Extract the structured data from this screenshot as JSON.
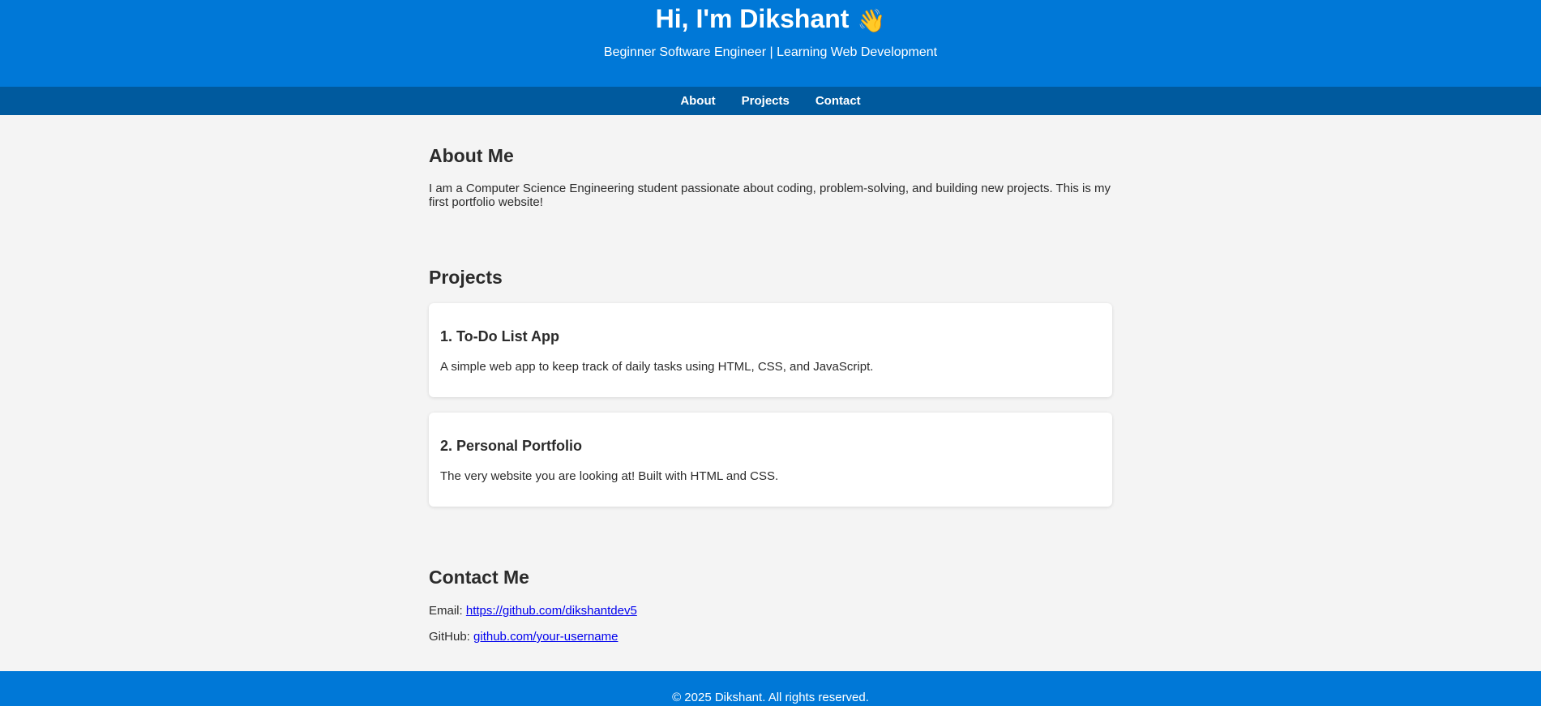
{
  "header": {
    "title": "Hi, I'm Dikshant",
    "wave_emoji": "👋",
    "subtitle": "Beginner Software Engineer | Learning Web Development",
    "background_color": "#0078d7"
  },
  "nav": {
    "background_color": "#005a9e",
    "items": [
      {
        "label": "About"
      },
      {
        "label": "Projects"
      },
      {
        "label": "Contact"
      }
    ]
  },
  "about": {
    "heading": "About Me",
    "text": "I am a Computer Science Engineering student passionate about coding, problem-solving, and building new projects. This is my first portfolio website!"
  },
  "projects": {
    "heading": "Projects",
    "items": [
      {
        "title": "1. To-Do List App",
        "description": "A simple web app to keep track of daily tasks using HTML, CSS, and JavaScript."
      },
      {
        "title": "2. Personal Portfolio",
        "description": "The very website you are looking at! Built with HTML and CSS."
      }
    ]
  },
  "contact": {
    "heading": "Contact Me",
    "email_label": "Email:",
    "email_link": "https://github.com/dikshantdev5",
    "github_label": "GitHub:",
    "github_link": "github.com/your-username",
    "link_color": "#0000ee"
  },
  "footer": {
    "text": "© 2025 Dikshant. All rights reserved."
  }
}
